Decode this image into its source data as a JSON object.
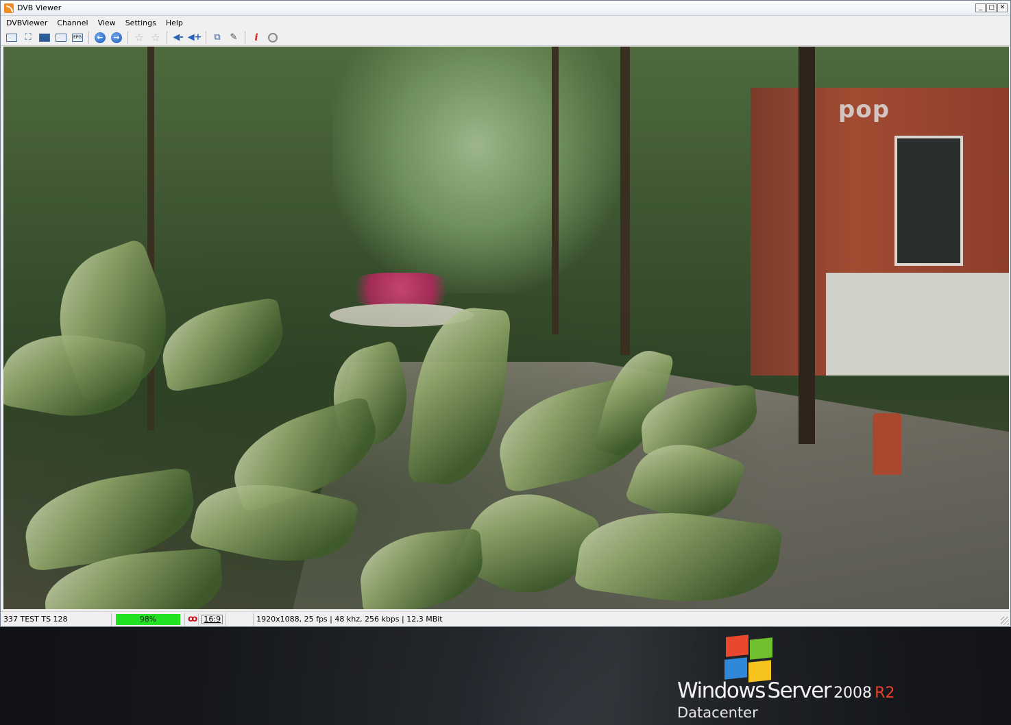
{
  "window": {
    "title": "DVB Viewer",
    "controls": {
      "minimize": "_",
      "maximize": "□",
      "close": "✕"
    }
  },
  "menu": [
    "DVBViewer",
    "Channel",
    "View",
    "Settings",
    "Help"
  ],
  "toolbar": {
    "icons": [
      "window-mode-icon",
      "fullscreen-icon",
      "desktop-icon",
      "osd-icon",
      "epg-icon",
      "back-icon",
      "forward-icon",
      "favorite-icon",
      "favorite-add-icon",
      "volume-down-icon",
      "volume-up-icon",
      "snapshot-icon",
      "settings-icon",
      "info-icon",
      "record-icon"
    ],
    "epg_label": "EPG"
  },
  "video": {
    "osd_logo": "pop"
  },
  "statusbar": {
    "channel": "337 TEST TS 128",
    "signal": "98%",
    "signal_value": 98,
    "signal_color": "#22e022",
    "aspect": "16:9",
    "stream_info": "1920x1088, 25 fps | 48 khz, 256 kbps | 12,3 MBit"
  },
  "desktop": {
    "brand_windows": "Windows",
    "brand_server": "Server",
    "brand_year": "2008",
    "brand_release": "R2",
    "brand_edition": "Datacenter",
    "accent_red": "#e8412b"
  }
}
